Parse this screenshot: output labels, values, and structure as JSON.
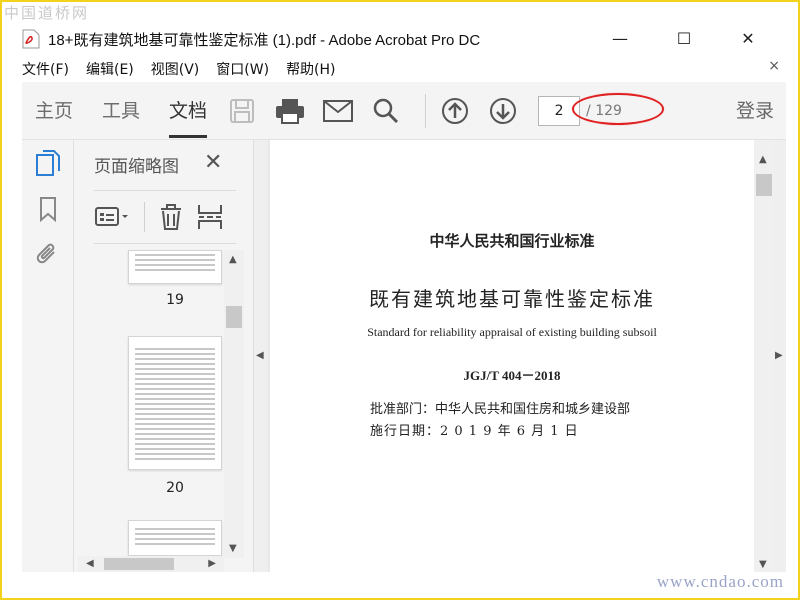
{
  "watermark": {
    "top": "中国道桥网",
    "bottom": "www.cndao.com"
  },
  "window": {
    "title": "18+既有建筑地基可靠性鉴定标准 (1).pdf - Adobe Acrobat Pro DC",
    "minimize": "—",
    "maximize": "☐",
    "close": "✕"
  },
  "menu": {
    "items": [
      "文件(F)",
      "编辑(E)",
      "视图(V)",
      "窗口(W)",
      "帮助(H)"
    ],
    "close": "×"
  },
  "toolbar": {
    "tabs": [
      "主页",
      "工具",
      "文档"
    ],
    "active_tab": "文档",
    "current_page": "2",
    "total_pages": "/ 129",
    "login": "登录",
    "icons": [
      "save-icon",
      "print-icon",
      "mail-icon",
      "search-icon",
      "page-up-icon",
      "page-down-icon"
    ]
  },
  "rail": {
    "icons": [
      "pages-icon",
      "bookmark-icon",
      "attachment-icon"
    ]
  },
  "thumbnails": {
    "title": "页面缩略图",
    "close": "✕",
    "pages": [
      "19",
      "20"
    ]
  },
  "document": {
    "org": "中华人民共和国行业标准",
    "title_cn": "既有建筑地基可靠性鉴定标准",
    "title_en": "Standard for reliability appraisal of existing building subsoil",
    "code": "JGJ/T 404－2018",
    "approval": "批准部门：中华人民共和国住房和城乡建设部",
    "date": "施行日期：2 0 1 9  年  6  月  1  日"
  },
  "colors": {
    "frame": "#f2d21a",
    "highlight_ring": "#e02020",
    "toolbar_bg": "#f4f4f4",
    "doc_icon_blue": "#2a7fd4"
  }
}
